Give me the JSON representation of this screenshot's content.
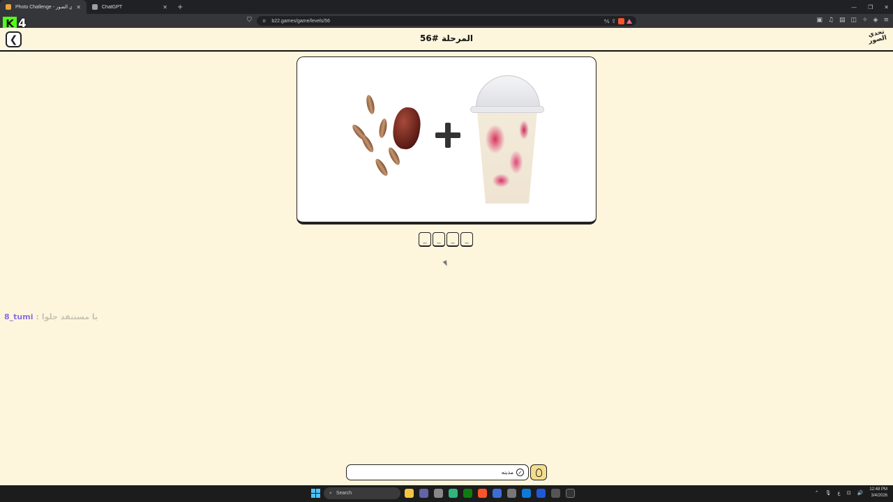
{
  "browser": {
    "tabs": [
      {
        "title": "Photo Challenge - تحدي الصور",
        "active": true
      },
      {
        "title": "ChatGPT",
        "active": false
      }
    ],
    "url": "b22.games/game/levels/56"
  },
  "overlay": {
    "number": "4"
  },
  "header": {
    "title": "المرحلة #56",
    "logo_text": "تحدي الصور"
  },
  "puzzle": {
    "images": [
      "dates-icon",
      "plus-icon",
      "milkshake-cup-icon"
    ],
    "answer_length": 4,
    "slots": [
      "_",
      "_",
      "_",
      "_"
    ]
  },
  "chat": {
    "user": "8_tumi",
    "separator": ":",
    "message": "يا مستنفد جلوا"
  },
  "answer_input": {
    "value": "مدينه",
    "placeholder": ""
  },
  "taskbar": {
    "search_label": "Search",
    "lang": "ع",
    "time": "12:48 PM",
    "date": "3/4/2026"
  },
  "colors": {
    "page_bg": "#fdf6dc",
    "accent_green": "#53fc18",
    "hint_yellow": "#f3dd8e"
  }
}
